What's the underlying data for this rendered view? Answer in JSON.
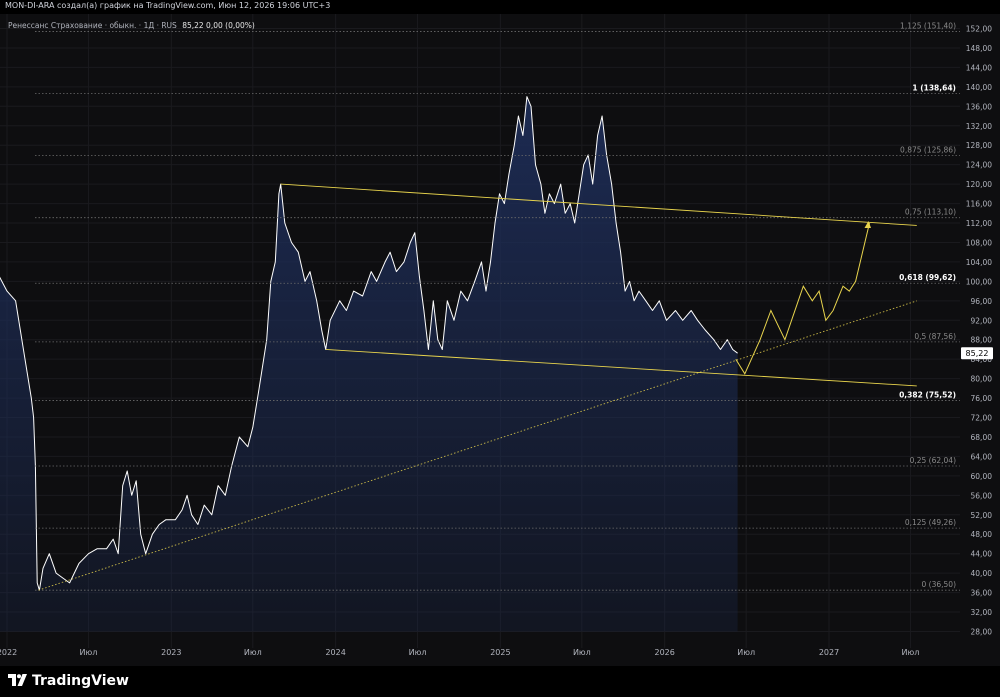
{
  "header": {
    "attribution": "MON-DI-ARA создал(а) график на TradingView.com, Июн 12, 2026 19:06 UTC+3"
  },
  "legend": {
    "symbol": "Ренессанс Страхование · обыкн. · 1Д · RUS",
    "values": "85,22  0,00 (0,00%)"
  },
  "footer": {
    "brand": "TradingView"
  },
  "colors": {
    "background": "#0e0e10",
    "area_fill": "#1d2c55",
    "line": "#ffffff",
    "channel": "#e8d44d",
    "fib": "#6b6b6b",
    "price_tag": "#ffffff"
  },
  "chart_data": {
    "type": "area",
    "title": "Ренессанс Страхование · обыкн. · 1Д · RUS",
    "xlabel": "",
    "ylabel": "",
    "ylim": [
      27,
      154
    ],
    "y_ticks": [
      "28,00",
      "32,00",
      "36,00",
      "40,00",
      "44,00",
      "48,00",
      "52,00",
      "56,00",
      "60,00",
      "64,00",
      "68,00",
      "72,00",
      "76,00",
      "80,00",
      "84,00",
      "88,00",
      "92,00",
      "96,00",
      "100,00",
      "104,00",
      "108,00",
      "112,00",
      "116,00",
      "120,00",
      "124,00",
      "128,00",
      "132,00",
      "136,00",
      "140,00",
      "144,00",
      "148,00",
      "152,00"
    ],
    "x_ticks": [
      {
        "label": "2022",
        "date": "2022-01-01"
      },
      {
        "label": "Июл",
        "date": "2022-07-01"
      },
      {
        "label": "2023",
        "date": "2023-01-01"
      },
      {
        "label": "Июл",
        "date": "2023-07-01"
      },
      {
        "label": "2024",
        "date": "2024-01-01"
      },
      {
        "label": "Июл",
        "date": "2024-07-01"
      },
      {
        "label": "2025",
        "date": "2025-01-01"
      },
      {
        "label": "Июл",
        "date": "2025-07-01"
      },
      {
        "label": "2026",
        "date": "2026-01-01"
      },
      {
        "label": "Июл",
        "date": "2026-07-01"
      },
      {
        "label": "2027",
        "date": "2027-01-01"
      },
      {
        "label": "Июл",
        "date": "2027-07-01"
      }
    ],
    "last_price": "85,22",
    "series": [
      {
        "points": [
          [
            "2021-12-15",
            101
          ],
          [
            "2022-01-01",
            98
          ],
          [
            "2022-01-20",
            96
          ],
          [
            "2022-02-10",
            84
          ],
          [
            "2022-02-24",
            76
          ],
          [
            "2022-03-01",
            72
          ],
          [
            "2022-03-05",
            62
          ],
          [
            "2022-03-09",
            38
          ],
          [
            "2022-03-14",
            36.5
          ],
          [
            "2022-03-22",
            41
          ],
          [
            "2022-04-05",
            44
          ],
          [
            "2022-04-20",
            40
          ],
          [
            "2022-05-05",
            39
          ],
          [
            "2022-05-20",
            38
          ],
          [
            "2022-06-10",
            42
          ],
          [
            "2022-07-01",
            44
          ],
          [
            "2022-07-20",
            45
          ],
          [
            "2022-08-10",
            45
          ],
          [
            "2022-08-25",
            47
          ],
          [
            "2022-09-05",
            44
          ],
          [
            "2022-09-15",
            58
          ],
          [
            "2022-09-25",
            61
          ],
          [
            "2022-10-05",
            56
          ],
          [
            "2022-10-15",
            59
          ],
          [
            "2022-10-25",
            48
          ],
          [
            "2022-11-05",
            44
          ],
          [
            "2022-11-20",
            48
          ],
          [
            "2022-12-05",
            50
          ],
          [
            "2022-12-20",
            51
          ],
          [
            "2023-01-10",
            51
          ],
          [
            "2023-01-25",
            53
          ],
          [
            "2023-02-05",
            56
          ],
          [
            "2023-02-15",
            52
          ],
          [
            "2023-03-01",
            50
          ],
          [
            "2023-03-15",
            54
          ],
          [
            "2023-04-01",
            52
          ],
          [
            "2023-04-15",
            58
          ],
          [
            "2023-05-01",
            56
          ],
          [
            "2023-05-15",
            62
          ],
          [
            "2023-06-01",
            68
          ],
          [
            "2023-06-20",
            66
          ],
          [
            "2023-07-01",
            70
          ],
          [
            "2023-07-15",
            78
          ],
          [
            "2023-08-01",
            88
          ],
          [
            "2023-08-10",
            100
          ],
          [
            "2023-08-20",
            104
          ],
          [
            "2023-08-28",
            118
          ],
          [
            "2023-09-01",
            120
          ],
          [
            "2023-09-10",
            112
          ],
          [
            "2023-09-25",
            108
          ],
          [
            "2023-10-10",
            106
          ],
          [
            "2023-10-25",
            100
          ],
          [
            "2023-11-05",
            102
          ],
          [
            "2023-11-20",
            96
          ],
          [
            "2023-12-01",
            90
          ],
          [
            "2023-12-10",
            86
          ],
          [
            "2023-12-20",
            92
          ],
          [
            "2024-01-10",
            96
          ],
          [
            "2024-01-25",
            94
          ],
          [
            "2024-02-10",
            98
          ],
          [
            "2024-03-01",
            97
          ],
          [
            "2024-03-20",
            102
          ],
          [
            "2024-04-01",
            100
          ],
          [
            "2024-04-20",
            104
          ],
          [
            "2024-05-01",
            106
          ],
          [
            "2024-05-15",
            102
          ],
          [
            "2024-06-01",
            104
          ],
          [
            "2024-06-15",
            108
          ],
          [
            "2024-06-25",
            110
          ],
          [
            "2024-07-05",
            101
          ],
          [
            "2024-07-15",
            94
          ],
          [
            "2024-07-25",
            86
          ],
          [
            "2024-08-05",
            96
          ],
          [
            "2024-08-15",
            88
          ],
          [
            "2024-08-25",
            86
          ],
          [
            "2024-09-05",
            96
          ],
          [
            "2024-09-20",
            92
          ],
          [
            "2024-10-05",
            98
          ],
          [
            "2024-10-20",
            96
          ],
          [
            "2024-11-05",
            100
          ],
          [
            "2024-11-20",
            104
          ],
          [
            "2024-11-30",
            98
          ],
          [
            "2024-12-10",
            104
          ],
          [
            "2024-12-20",
            112
          ],
          [
            "2024-12-30",
            118
          ],
          [
            "2025-01-10",
            116
          ],
          [
            "2025-01-20",
            122
          ],
          [
            "2025-02-01",
            128
          ],
          [
            "2025-02-10",
            134
          ],
          [
            "2025-02-20",
            130
          ],
          [
            "2025-03-01",
            138
          ],
          [
            "2025-03-10",
            136
          ],
          [
            "2025-03-20",
            124
          ],
          [
            "2025-04-01",
            120
          ],
          [
            "2025-04-10",
            114
          ],
          [
            "2025-04-20",
            118
          ],
          [
            "2025-05-01",
            116
          ],
          [
            "2025-05-15",
            120
          ],
          [
            "2025-05-25",
            114
          ],
          [
            "2025-06-05",
            116
          ],
          [
            "2025-06-15",
            112
          ],
          [
            "2025-06-25",
            118
          ],
          [
            "2025-07-05",
            124
          ],
          [
            "2025-07-15",
            126
          ],
          [
            "2025-07-25",
            120
          ],
          [
            "2025-08-05",
            130
          ],
          [
            "2025-08-15",
            134
          ],
          [
            "2025-08-25",
            126
          ],
          [
            "2025-09-05",
            120
          ],
          [
            "2025-09-15",
            112
          ],
          [
            "2025-09-25",
            106
          ],
          [
            "2025-10-05",
            98
          ],
          [
            "2025-10-15",
            100
          ],
          [
            "2025-10-25",
            96
          ],
          [
            "2025-11-05",
            98
          ],
          [
            "2025-11-20",
            96
          ],
          [
            "2025-12-05",
            94
          ],
          [
            "2025-12-20",
            96
          ],
          [
            "2026-01-05",
            92
          ],
          [
            "2026-01-25",
            94
          ],
          [
            "2026-02-10",
            92
          ],
          [
            "2026-03-01",
            94
          ],
          [
            "2026-03-15",
            92
          ],
          [
            "2026-04-01",
            90
          ],
          [
            "2026-04-20",
            88
          ],
          [
            "2026-05-05",
            86
          ],
          [
            "2026-05-20",
            88
          ],
          [
            "2026-06-01",
            86
          ],
          [
            "2026-06-12",
            85.22
          ]
        ]
      }
    ],
    "channel_upper": {
      "from": [
        "2023-09-01",
        120
      ],
      "to": [
        "2027-07-15",
        111.5
      ]
    },
    "channel_lower": {
      "from": [
        "2023-12-10",
        86
      ],
      "to": [
        "2027-07-15",
        78.5
      ]
    },
    "trend_support": {
      "from": [
        "2022-03-12",
        36.5
      ],
      "to": [
        "2027-07-15",
        96
      ]
    },
    "projection": [
      [
        "2026-06-08",
        84
      ],
      [
        "2026-06-28",
        81
      ],
      [
        "2026-08-01",
        88
      ],
      [
        "2026-08-25",
        94
      ],
      [
        "2026-09-25",
        88
      ],
      [
        "2026-11-05",
        99
      ],
      [
        "2026-11-25",
        96
      ],
      [
        "2026-12-10",
        98
      ],
      [
        "2026-12-25",
        92
      ],
      [
        "2027-01-10",
        94
      ],
      [
        "2027-02-01",
        99
      ],
      [
        "2027-02-15",
        98
      ],
      [
        "2027-03-01",
        100
      ],
      [
        "2027-04-01",
        112
      ]
    ],
    "fib_levels": [
      {
        "label": "1,125 (151,40)",
        "value": 151.4,
        "strong": false
      },
      {
        "label": "1 (138,64)",
        "value": 138.64,
        "strong": true
      },
      {
        "label": "0,875 (125,86)",
        "value": 125.86,
        "strong": false
      },
      {
        "label": "0,75 (113,10)",
        "value": 113.1,
        "strong": false
      },
      {
        "label": "0,618 (99,62)",
        "value": 99.62,
        "strong": true
      },
      {
        "label": "0,5 (87,56)",
        "value": 87.56,
        "strong": false
      },
      {
        "label": "0,382 (75,52)",
        "value": 75.52,
        "strong": true
      },
      {
        "label": "0,25 (62,04)",
        "value": 62.04,
        "strong": false
      },
      {
        "label": "0,125 (49,26)",
        "value": 49.26,
        "strong": false
      },
      {
        "label": "0 (36,50)",
        "value": 36.5,
        "strong": false
      }
    ]
  }
}
